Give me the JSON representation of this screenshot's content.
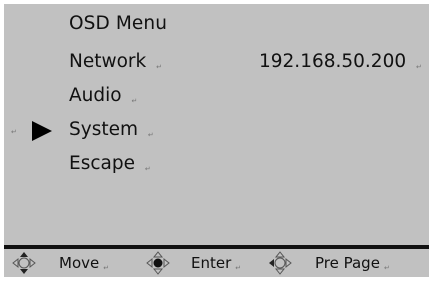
{
  "menu": {
    "title": "OSD Menu",
    "items": [
      {
        "label": "Network",
        "mark": "↵"
      },
      {
        "label": "Audio",
        "mark": "↵"
      },
      {
        "label": "System",
        "mark": "↵"
      },
      {
        "label": "Escape",
        "mark": "↵"
      }
    ],
    "network_value": "192.168.50.200",
    "network_value_mark": "↵",
    "selected_index": 2,
    "selected_item": "System",
    "pointer_mark": "↵"
  },
  "footer": {
    "move_label": "Move",
    "move_icon": "joystick-up-down-icon",
    "enter_label": "Enter",
    "enter_icon": "joystick-press-icon",
    "prev_label": "Pre Page",
    "prev_icon": "joystick-left-icon",
    "mark": "↵"
  },
  "colors": {
    "background": "#c1c1c1",
    "text": "#111111",
    "divider": "#111111"
  }
}
